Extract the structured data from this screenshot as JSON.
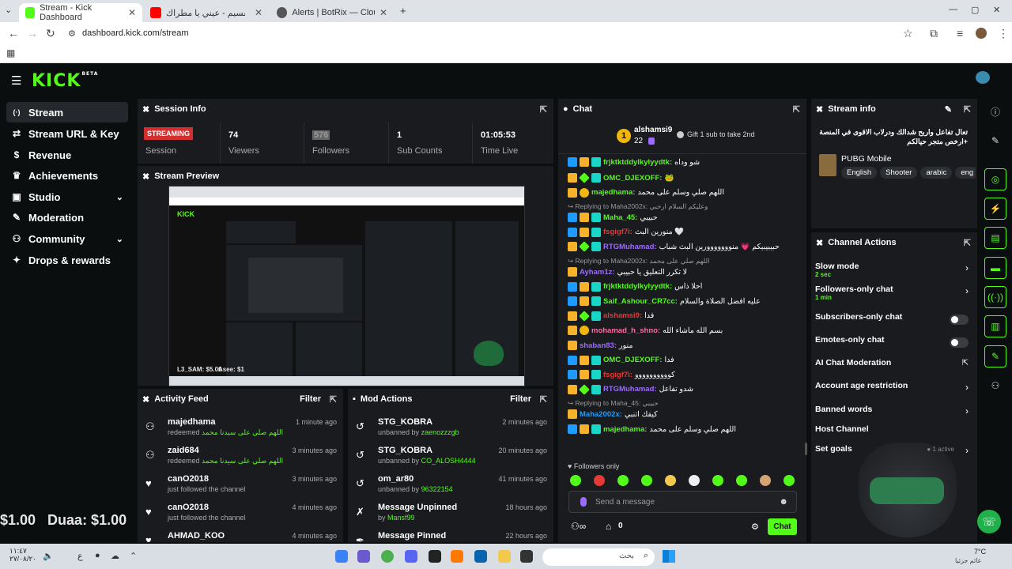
{
  "browser": {
    "tabs": [
      {
        "title": "Stream - Kick Dashboard"
      },
      {
        "title": "احمد القسيم - عيني يا مطراك"
      },
      {
        "title": "Alerts | BotRix — Cloud Stream"
      }
    ],
    "url": "dashboard.kick.com/stream"
  },
  "logo": {
    "text": "KICK",
    "beta": "BETA"
  },
  "sidebar": {
    "items": [
      {
        "label": "Stream",
        "icon": "(·)"
      },
      {
        "label": "Stream URL & Key",
        "icon": "⇄"
      },
      {
        "label": "Revenue",
        "icon": "$"
      },
      {
        "label": "Achievements",
        "icon": "🏆"
      },
      {
        "label": "Studio",
        "icon": "▣"
      },
      {
        "label": "Moderation",
        "icon": "✎"
      },
      {
        "label": "Community",
        "icon": "👥"
      },
      {
        "label": "Drops & rewards",
        "icon": "🎁"
      }
    ]
  },
  "session": {
    "title": "Session Info",
    "status": "STREAMING",
    "stats": [
      {
        "value": "Session",
        "label": ""
      },
      {
        "value": "74",
        "label": "Viewers"
      },
      {
        "value": "576",
        "label": "Followers"
      },
      {
        "value": "1",
        "label": "Sub Counts"
      },
      {
        "value": "01:05:53",
        "label": "Time Live"
      }
    ]
  },
  "preview": {
    "title": "Stream Preview"
  },
  "activity": {
    "title": "Activity Feed",
    "filter": "Filter",
    "rows": [
      {
        "name": "majedhama",
        "action": "redeemed",
        "detail": "اللهم صلي على سيدنا محمد",
        "time": "1 minute ago"
      },
      {
        "name": "zaid684",
        "action": "redeemed",
        "detail": "اللهم صلي على سيدنا محمد",
        "time": "3 minutes ago"
      },
      {
        "name": "canO2018",
        "action": "just followed the channel",
        "detail": "",
        "time": "3 minutes ago"
      },
      {
        "name": "canO2018",
        "action": "just followed the channel",
        "detail": "",
        "time": "4 minutes ago"
      },
      {
        "name": "AHMAD_KOO",
        "action": "",
        "detail": "",
        "time": "4 minutes ago"
      }
    ]
  },
  "mod": {
    "title": "Mod Actions",
    "filter": "Filter",
    "rows": [
      {
        "name": "STG_KOBRA",
        "action": "unbanned by",
        "by": "zaenozzzgb",
        "time": "2 minutes ago"
      },
      {
        "name": "STG_KOBRA",
        "action": "unbanned by",
        "by": "CO_ALOSH4444",
        "time": "20 minutes ago"
      },
      {
        "name": "om_ar80",
        "action": "unbanned by",
        "by": "96322154",
        "time": "41 minutes ago"
      },
      {
        "name": "Message Unpinned",
        "action": "by",
        "by": "Mansf99",
        "time": "18 hours ago"
      },
      {
        "name": "Message Pinned",
        "action": "",
        "by": "",
        "time": "22 hours ago"
      }
    ]
  },
  "chat": {
    "title": "Chat",
    "top_gifter": {
      "name": "alshamsi9",
      "count": "22",
      "rank": "1"
    },
    "gift_text": "Gift 1 sub to take 2nd",
    "messages": [
      {
        "type": "msg",
        "user": "frjktktddylkylyydtk",
        "color": "#53fc18",
        "text": "شو وداه"
      },
      {
        "type": "msg",
        "user": "OMC_DJEXOFF",
        "color": "#53fc18",
        "text": "🐸"
      },
      {
        "type": "msg",
        "user": "majedhama",
        "color": "#53fc18",
        "text": "اللهم صلي وسلم على محمد"
      },
      {
        "type": "reply",
        "text": "Replying to Maha2002x: وعليكم السلام ارحبي"
      },
      {
        "type": "msg",
        "user": "Maha_45",
        "color": "#53fc18",
        "text": "حبيبي"
      },
      {
        "type": "msg",
        "user": "fsgigf7i",
        "color": "#e53935",
        "text": "منورين البث 🤍"
      },
      {
        "type": "msg",
        "user": "RTGMuhamad",
        "color": "#9c6bff",
        "text": "حبيبيبيكم 💗 منووووووورين البث شباب"
      },
      {
        "type": "reply",
        "text": "Replying to Maha2002x: اللهم صلي على محمد"
      },
      {
        "type": "msg",
        "user": "Ayham1z",
        "color": "#9c6bff",
        "text": "لا تكرر التعليق يا حبيبي"
      },
      {
        "type": "msg",
        "user": "frjktktddylkylyydtk",
        "color": "#53fc18",
        "text": "احلا ذاس"
      },
      {
        "type": "msg",
        "user": "Saif_Ashour_CR7cc",
        "color": "#53fc18",
        "text": "عليه افضل الصلاة والسلام"
      },
      {
        "type": "msg",
        "user": "alshamsi9",
        "color": "#e53935",
        "text": "فدا"
      },
      {
        "type": "msg",
        "user": "mohamad_h_shno",
        "color": "#ff6b9d",
        "text": "بسم الله ماشاء الله"
      },
      {
        "type": "msg",
        "user": "shaban83",
        "color": "#9c6bff",
        "text": "منور"
      },
      {
        "type": "msg",
        "user": "OMC_DJEXOFF",
        "color": "#53fc18",
        "text": "فدا"
      },
      {
        "type": "msg",
        "user": "fsgigf7i",
        "color": "#e53935",
        "text": "كوووووووووو"
      },
      {
        "type": "msg",
        "user": "RTGMuhamad",
        "color": "#9c6bff",
        "text": "شدو تفاعل"
      },
      {
        "type": "reply",
        "text": "Replying to Maha_45: حبيبي"
      },
      {
        "type": "msg",
        "user": "Maha2002x",
        "color": "#1e9bff",
        "text": "كيفك اتنبي"
      },
      {
        "type": "msg",
        "user": "majedhama",
        "color": "#53fc18",
        "text": "اللهم صلي وسلم على محمد"
      }
    ],
    "followers_only": "Followers only",
    "placeholder": "Send a message",
    "points": "0",
    "send_label": "Chat"
  },
  "stream_info": {
    "title": "Stream info",
    "stream_title": "تعال تفاعل واربح شدالك ودرلاب الاقوى في المنصة +ارخص متجر حيالكم",
    "category": "PUBG Mobile",
    "tags": [
      "English",
      "Shooter",
      "arabic",
      "eng"
    ]
  },
  "channel_actions": {
    "title": "Channel Actions",
    "rows": [
      {
        "label": "Slow mode",
        "sub": "2 sec",
        "control": "arrow"
      },
      {
        "label": "Followers-only chat",
        "sub": "1 min",
        "control": "arrow"
      },
      {
        "label": "Subscribers-only chat",
        "sub": "",
        "control": "toggle"
      },
      {
        "label": "Emotes-only chat",
        "sub": "",
        "control": "toggle"
      },
      {
        "label": "AI Chat Moderation",
        "sub": "",
        "control": "external"
      },
      {
        "label": "Account age restriction",
        "sub": "",
        "control": "arrow"
      },
      {
        "label": "Banned words",
        "sub": "",
        "control": "arrow"
      },
      {
        "label": "Host Channel",
        "sub": "",
        "control": "none"
      },
      {
        "label": "Set goals",
        "sub": "1 active",
        "control": "arrow"
      }
    ]
  },
  "overlay": {
    "ticker": "$1.00   Duaa: $1.00   Dua"
  },
  "taskbar": {
    "weather": "7°C",
    "weather_sub": "غائم جزئيا",
    "time": "١١:٤٧",
    "date": "٢٧/٠٨/٢٠",
    "search": "بحث"
  },
  "colors": {
    "brand": "#53fc18",
    "panel": "#191b1f",
    "bg": "#0b0e0f"
  }
}
